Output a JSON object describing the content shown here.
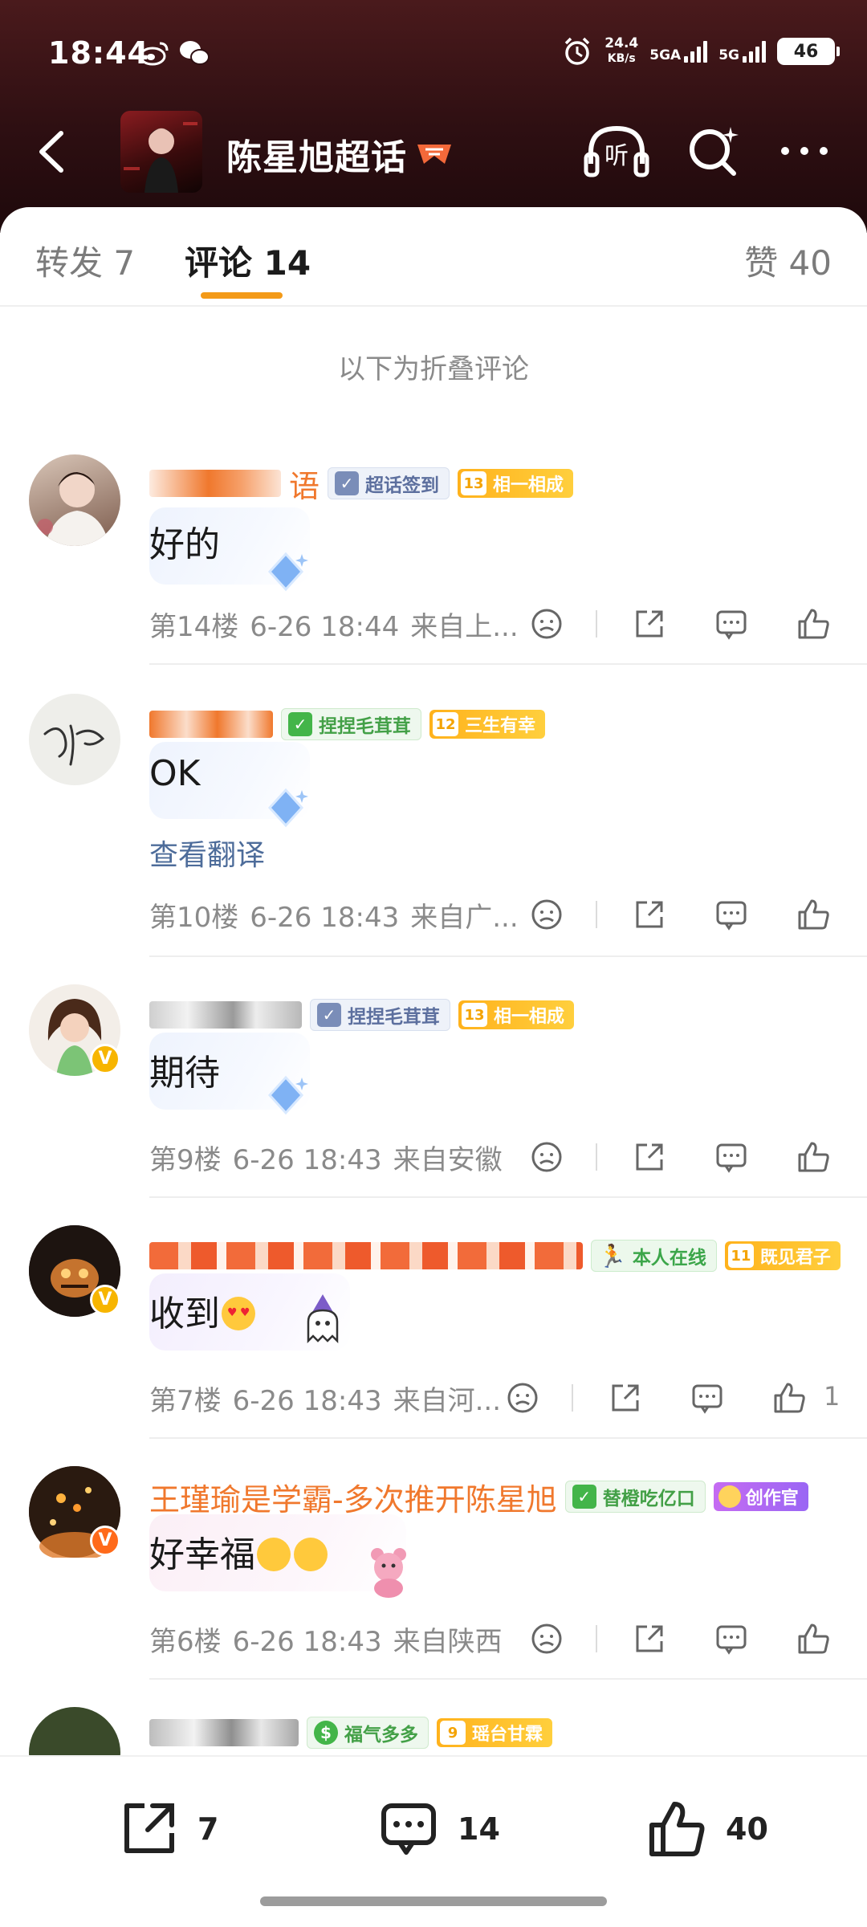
{
  "status_bar": {
    "time": "18:44",
    "speed_value": "24.4",
    "speed_unit": "KB/s",
    "network1": "5GA",
    "network2": "5G",
    "battery": "46"
  },
  "nav": {
    "title": "陈星旭超话",
    "listen_label": "听"
  },
  "tabs": {
    "repost": "转发 7",
    "comment": "评论 14",
    "like": "赞 40"
  },
  "folded_notice": "以下为折叠评论",
  "comments": [
    {
      "name_visible": "语",
      "tag1": "超话签到",
      "tag2_level": "13",
      "tag2": "相一相成",
      "text": "好的",
      "floor": "第14楼",
      "time": "6-26 18:44",
      "location": "来自上...",
      "likes": ""
    },
    {
      "tag1": "捏捏毛茸茸",
      "tag2_level": "12",
      "tag2": "三生有幸",
      "text": "OK",
      "translate": "查看翻译",
      "floor": "第10楼",
      "time": "6-26 18:43",
      "location": "来自广...",
      "likes": ""
    },
    {
      "tag1": "捏捏毛茸茸",
      "tag2_level": "13",
      "tag2": "相一相成",
      "text": "期待",
      "floor": "第9楼",
      "time": "6-26 18:43",
      "location": "来自安徽",
      "likes": ""
    },
    {
      "tag1": "本人在线",
      "tag2_level": "11",
      "tag2": "既见君子",
      "text": "收到",
      "floor": "第7楼",
      "time": "6-26 18:43",
      "location": "来自河...",
      "likes": "1"
    },
    {
      "name": "王瑾瑜是学霸-多次推开陈星旭",
      "tag1": "替橙吃亿口",
      "tag2": "创作官",
      "text": "好幸福",
      "floor": "第6楼",
      "time": "6-26 18:43",
      "location": "来自陕西",
      "likes": ""
    },
    {
      "tag1": "福气多多",
      "tag2_level": "9",
      "tag2": "瑶台甘霖"
    }
  ],
  "bottom_bar": {
    "repost_count": "7",
    "comment_count": "14",
    "like_count": "40"
  },
  "colors": {
    "header_bg": "#2e0f12",
    "accent_orange": "#f39a18",
    "username_orange": "#f0782d",
    "link_blue": "#4d6c9a",
    "meta_gray": "#8a8a8a"
  },
  "icons": [
    "weibo-icon",
    "wechat-icon",
    "alarm-icon",
    "back-icon",
    "listen-icon",
    "search-icon",
    "more-icon",
    "dislike-icon",
    "share-icon",
    "comment-icon",
    "like-icon"
  ]
}
